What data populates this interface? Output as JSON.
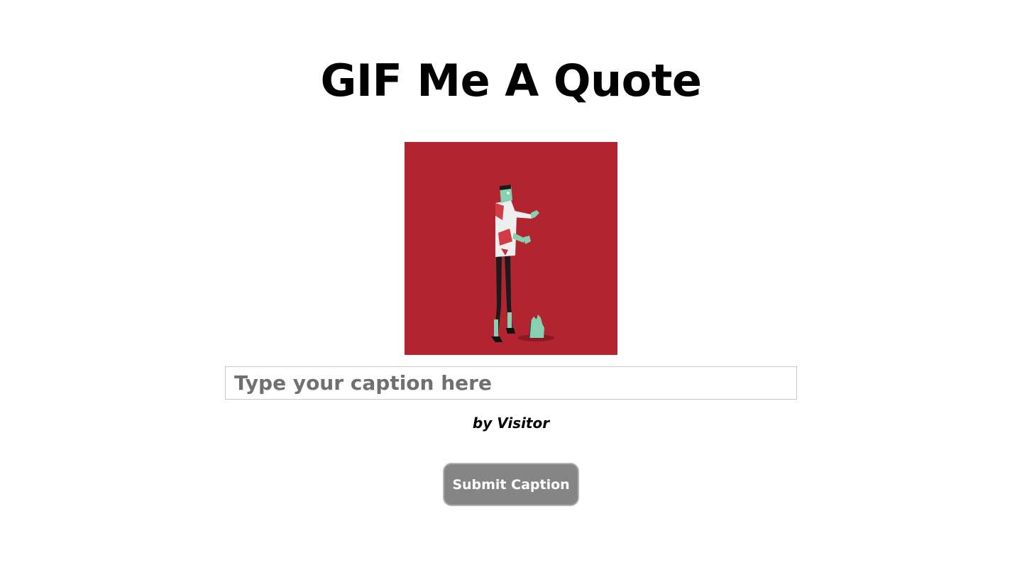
{
  "page": {
    "title": "GIF Me A Quote"
  },
  "gif": {
    "subject": "zombie-illustration",
    "background_color": "#B32431"
  },
  "caption": {
    "placeholder": "Type your caption here",
    "value": ""
  },
  "byline": {
    "text": "by Visitor"
  },
  "submit": {
    "label": "Submit Caption",
    "color": "#858585"
  }
}
